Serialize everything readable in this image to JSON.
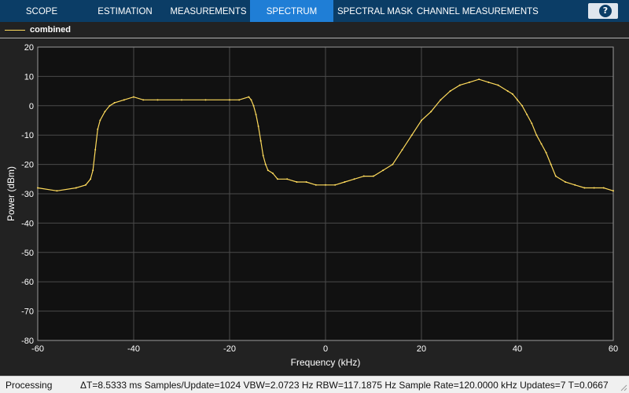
{
  "toolbar": {
    "tabs": [
      {
        "label": "SCOPE",
        "active": false
      },
      {
        "label": "ESTIMATION",
        "active": false
      },
      {
        "label": "MEASUREMENTS",
        "active": false
      },
      {
        "label": "SPECTRUM",
        "active": true
      },
      {
        "label": "SPECTRAL MASK",
        "active": false
      },
      {
        "label": "CHANNEL MEASUREMENTS",
        "active": false
      }
    ],
    "help_label": "?"
  },
  "legend": {
    "label": "combined",
    "color": "#ffdb5c"
  },
  "status": {
    "state": "Processing",
    "info": "ΔT=8.5333 ms  Samples/Update=1024  VBW=2.0723 Hz  RBW=117.1875 Hz  Sample Rate=120.0000 kHz  Updates=7  T=0.0667"
  },
  "colors": {
    "toolbar_bg": "#0b3d66",
    "active_tab": "#1f7ed6",
    "plot_bg": "#111111",
    "figure_bg": "#222222",
    "trace": "#ffdb5c"
  },
  "chart_data": {
    "type": "line",
    "title": "",
    "xlabel": "Frequency (kHz)",
    "ylabel": "Power (dBm)",
    "xlim": [
      -60,
      60
    ],
    "ylim": [
      -80,
      20
    ],
    "xticks": [
      -60,
      -40,
      -20,
      0,
      20,
      40,
      60
    ],
    "yticks": [
      20,
      10,
      0,
      -10,
      -20,
      -30,
      -40,
      -50,
      -60,
      -70,
      -80
    ],
    "grid": true,
    "legend_position": "top-left",
    "series": [
      {
        "name": "combined",
        "color": "#ffdb5c",
        "x": [
          -60,
          -56,
          -52,
          -50,
          -49,
          -48.5,
          -48,
          -47.5,
          -47,
          -46,
          -45,
          -44,
          -42,
          -40,
          -38,
          -35,
          -30,
          -25,
          -20,
          -18,
          -16,
          -15.5,
          -15,
          -14.5,
          -14,
          -13.5,
          -13,
          -12.5,
          -12,
          -11,
          -10,
          -8,
          -6,
          -4,
          -2,
          0,
          2,
          4,
          6,
          8,
          10,
          12,
          14,
          16,
          18,
          20,
          22,
          24,
          26,
          28,
          30,
          32,
          34,
          36,
          38,
          39,
          40,
          41,
          42,
          43,
          44,
          45,
          46,
          47,
          48,
          50,
          52,
          54,
          56,
          58,
          60
        ],
        "y": [
          -28,
          -29,
          -28,
          -27,
          -25,
          -22,
          -15,
          -8,
          -5,
          -2,
          0,
          1,
          2,
          3,
          2,
          2,
          2,
          2,
          2,
          2,
          3,
          2,
          0,
          -3,
          -7,
          -12,
          -17,
          -20,
          -22,
          -23,
          -25,
          -25,
          -26,
          -26,
          -27,
          -27,
          -27,
          -26,
          -25,
          -24,
          -24,
          -22,
          -20,
          -15,
          -10,
          -5,
          -2,
          2,
          5,
          7,
          8,
          9,
          8,
          7,
          5,
          4,
          2,
          0,
          -3,
          -6,
          -10,
          -13,
          -16,
          -20,
          -24,
          -26,
          -27,
          -28,
          -28,
          -28,
          -29
        ]
      }
    ]
  }
}
